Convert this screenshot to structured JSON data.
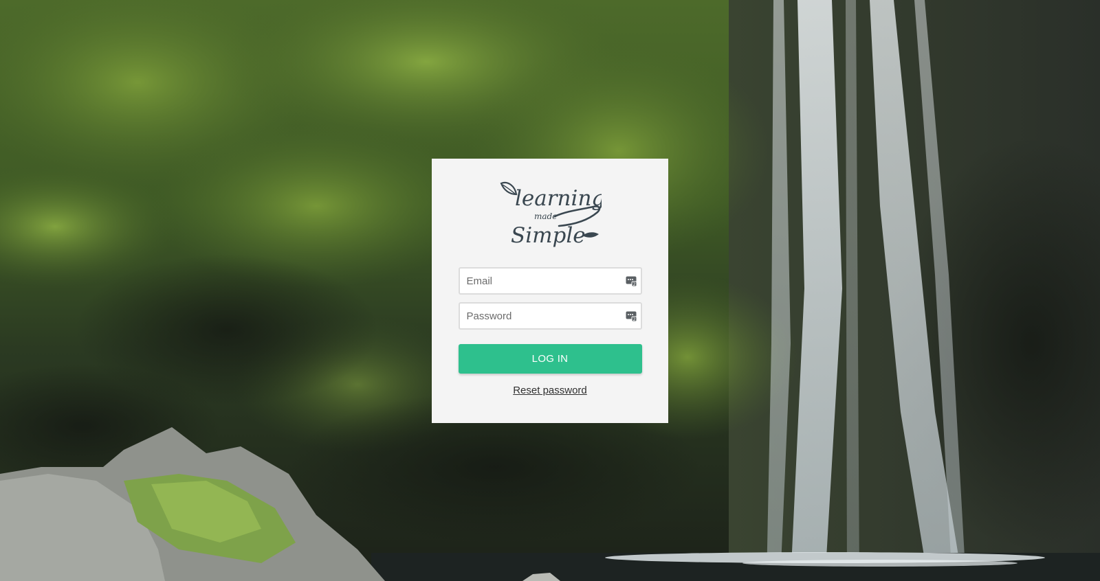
{
  "brand": {
    "logo_text_line1": "learning",
    "logo_text_line2": "made",
    "logo_text_line3": "Simple",
    "logo_color": "#3a4750"
  },
  "login_form": {
    "email_placeholder": "Email",
    "password_placeholder": "Password",
    "login_label": "LOG IN",
    "reset_label": "Reset password"
  },
  "colors": {
    "accent": "#2ec08d",
    "card_bg": "#f4f4f4"
  },
  "icons": {
    "field_icon": "password-manager-icon"
  }
}
